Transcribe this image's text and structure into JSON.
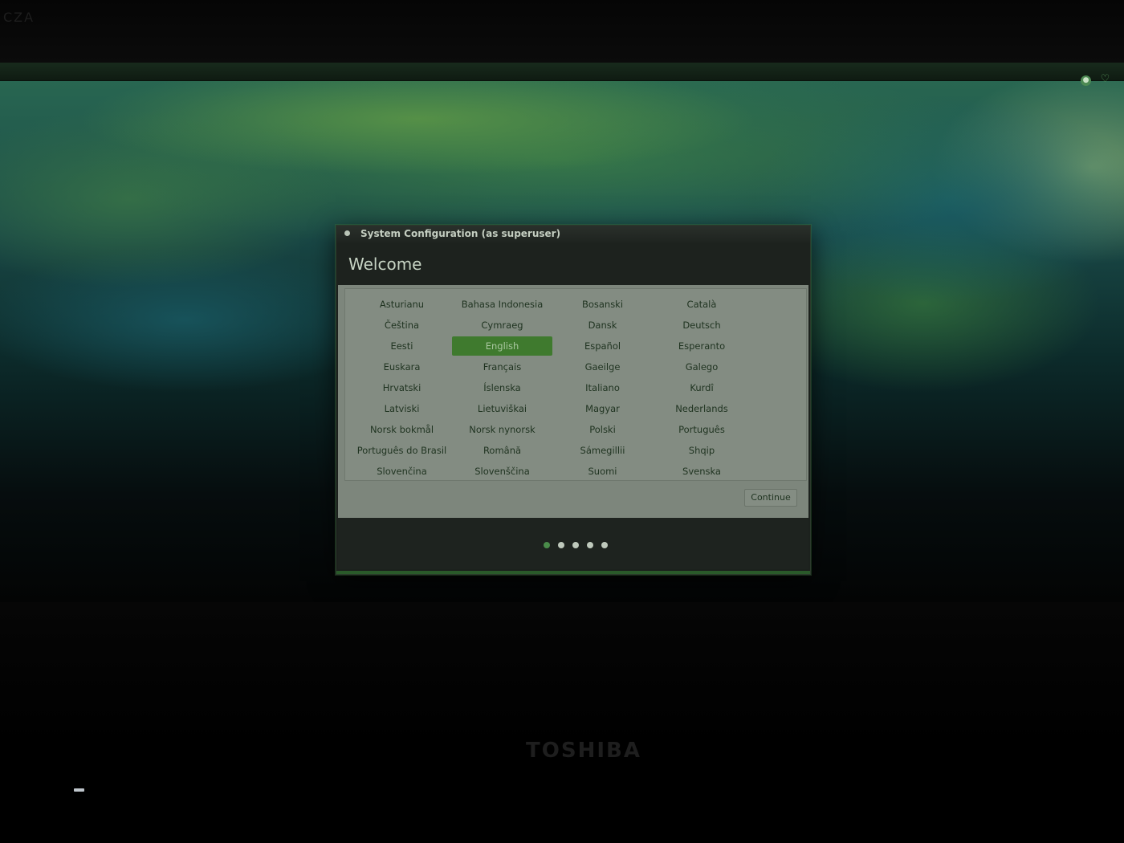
{
  "bezel": {
    "top_mark": "CZA",
    "brand": "TOSHIBA"
  },
  "desktop": {
    "tray_icons": [
      "accessibility-icon",
      "heart-icon"
    ]
  },
  "dialog": {
    "window_title": "System Configuration (as superuser)",
    "header_title": "Welcome",
    "selected_language": "English",
    "languages": [
      "Asturianu",
      "Bahasa Indonesia",
      "Bosanski",
      "Català",
      "Čeština",
      "Cymraeg",
      "Dansk",
      "Deutsch",
      "Eesti",
      "English",
      "Español",
      "Esperanto",
      "Euskara",
      "Français",
      "Gaeilge",
      "Galego",
      "Hrvatski",
      "Íslenska",
      "Italiano",
      "Kurdî",
      "Latviski",
      "Lietuviškai",
      "Magyar",
      "Nederlands",
      "Norsk bokmål",
      "Norsk nynorsk",
      "Polski",
      "Português",
      "Português do Brasil",
      "Română",
      "Sámegillii",
      "Shqip",
      "Slovenčina",
      "Slovenščina",
      "Suomi",
      "Svenska"
    ],
    "continue_label": "Continue",
    "progress": {
      "total_steps": 5,
      "current_step": 1
    }
  },
  "colors": {
    "accent": "#3f7a2e",
    "dialog_dark": "#1c211d",
    "content_bg": "#7d867c"
  }
}
